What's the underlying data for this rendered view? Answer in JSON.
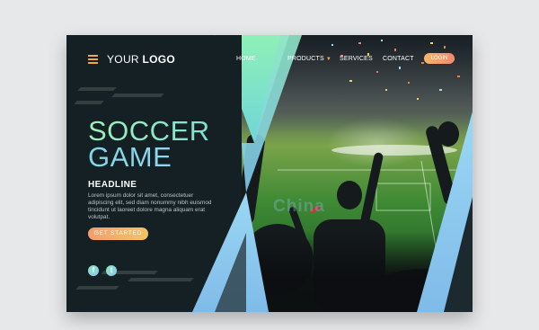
{
  "nav": {
    "logo_your": "YOUR",
    "logo_logo": "LOGO",
    "items": [
      "HOME",
      "PRODUCTS",
      "SERVICES",
      "CONTACT"
    ],
    "login": "LOGIN",
    "menu_icon": "hamburger-menu-icon",
    "dropdown_icon": "caret-down-icon"
  },
  "hero": {
    "title_line1": "SOCCER",
    "title_line2": "GAME",
    "headline": "HEADLINE",
    "body": "Lorem ipsum dolor sit amet, consectetuer adipiscing elit, sed diam nonummy nibh euismod tincidunt ut laoreet dolore magna aliquam erat volutpat.",
    "cta": "GET STARTED"
  },
  "social": [
    {
      "icon": "facebook-icon",
      "glyph": "f"
    },
    {
      "icon": "twitter-icon",
      "glyph": "t"
    }
  ],
  "colors": {
    "background": "#142024",
    "accent_orange": "#f1a64b",
    "gradient_mint": "#9ef2b8",
    "gradient_blue": "#8cc9ef"
  },
  "watermark": "China"
}
